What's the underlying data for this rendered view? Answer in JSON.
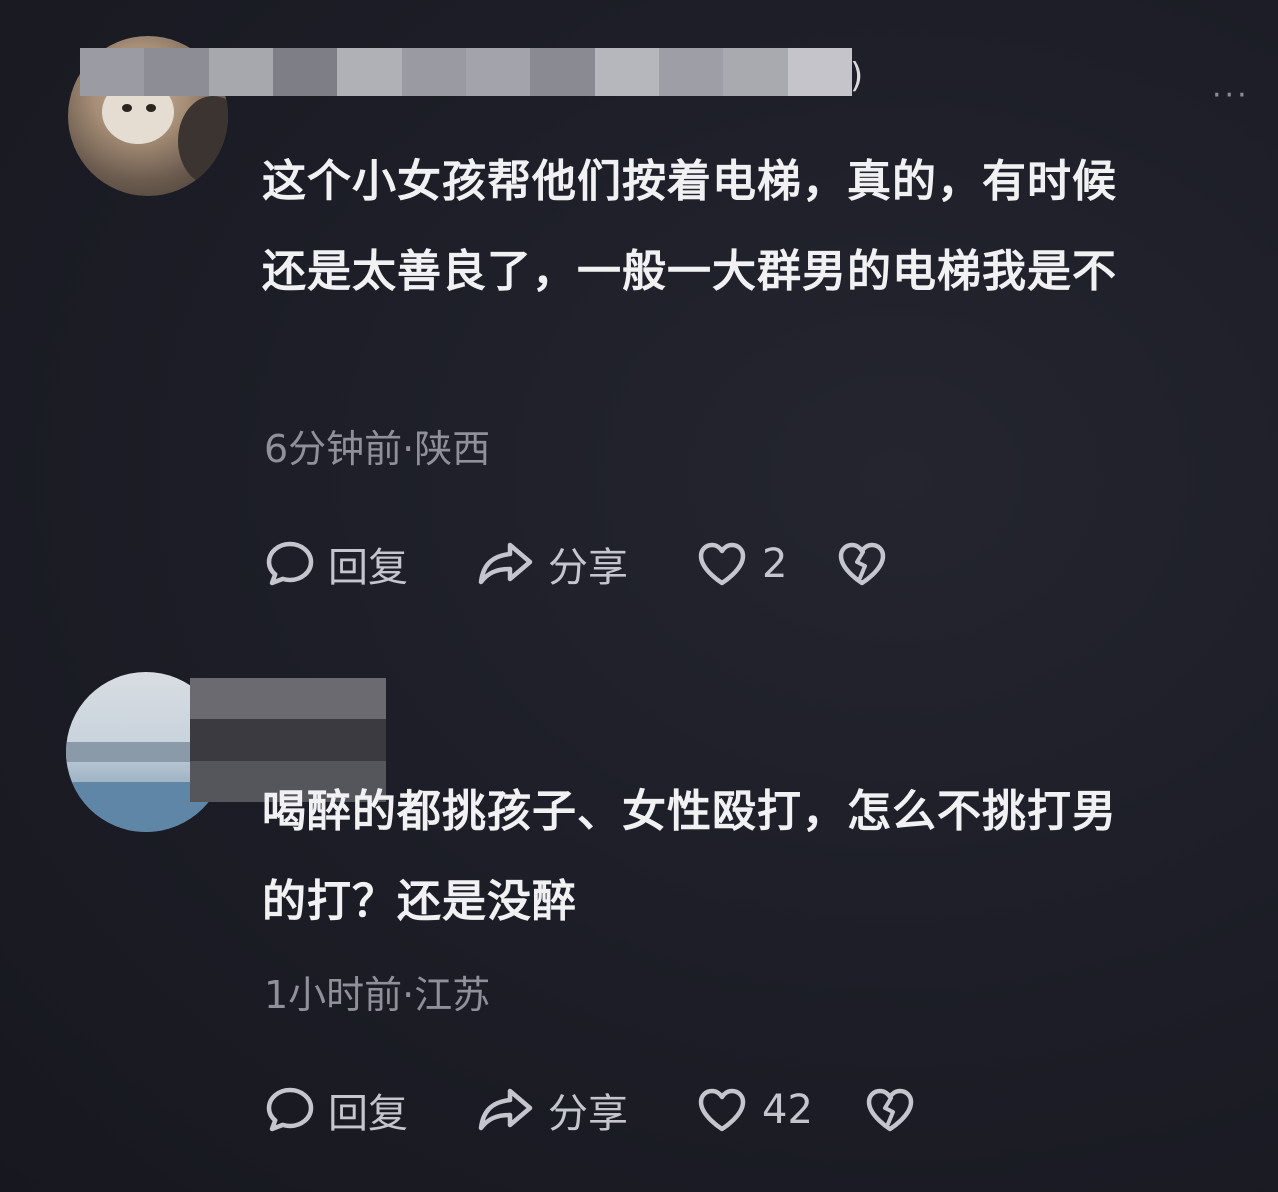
{
  "comments": [
    {
      "username_visible": ")",
      "text_line1": "这个小女孩帮他们按着电梯，真的，有时候",
      "text_line2": "还是太善良了，一般一大群男的电梯我是不",
      "meta": "6分钟前·陕西",
      "actions": {
        "reply": "回复",
        "share": "分享",
        "likes": "2"
      }
    },
    {
      "username_visible": "",
      "text_line1": "喝醉的都挑孩子、女性殴打，怎么不挑打男",
      "text_line2": "的打？还是没醉",
      "meta": "1小时前·江苏",
      "actions": {
        "reply": "回复",
        "share": "分享",
        "likes": "42"
      }
    }
  ],
  "more_menu": "···",
  "icons": {
    "reply": "speech-bubble-icon",
    "share": "share-arrow-icon",
    "like": "heart-icon",
    "dislike": "broken-heart-icon"
  },
  "colors": {
    "background": "#1c1d26",
    "text": "#f1f1f4",
    "meta": "#8f909a",
    "action": "#c4c5cd"
  }
}
